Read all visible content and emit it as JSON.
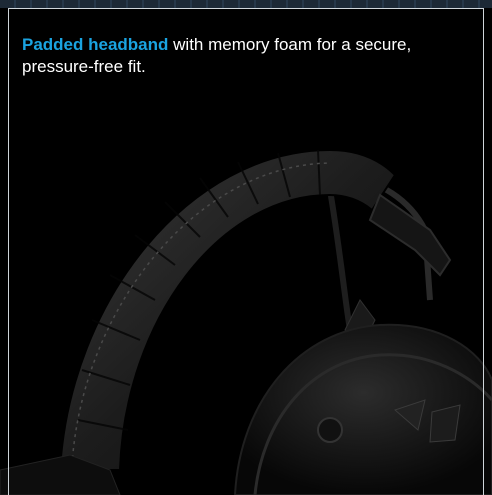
{
  "caption": {
    "highlight": "Padded headband",
    "text": " with memory foam for a secure, pressure-free fit."
  },
  "colors": {
    "highlight": "#1aa3e0",
    "background": "#000000",
    "border": "#cfd5da"
  },
  "image": {
    "subject": "headphones-headband-photo",
    "icon": "headphones-icon"
  }
}
